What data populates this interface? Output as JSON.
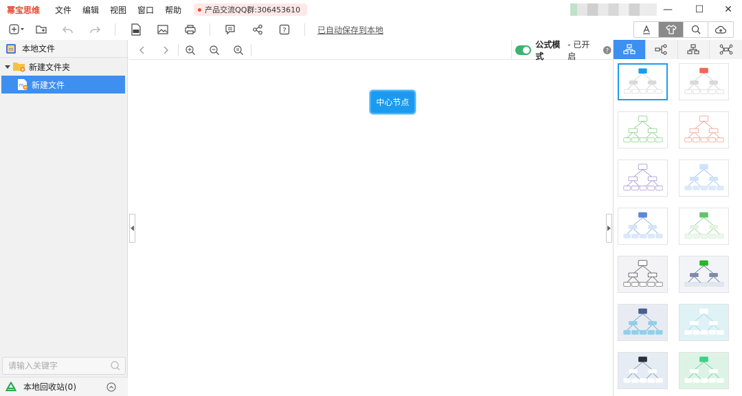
{
  "app": {
    "name": "幂宝思维"
  },
  "menu": [
    "文件",
    "编辑",
    "视图",
    "窗口",
    "帮助"
  ],
  "qq_badge": "产品交流QQ群:306453610",
  "window_controls": {
    "minimize": "—",
    "maximize": "☐",
    "close": "✕"
  },
  "toolbar": {
    "autosave_label": "已自动保存到本地"
  },
  "left_panel": {
    "header": "本地文件",
    "folder": "新建文件夹",
    "file": "新建文件",
    "search_placeholder": "请输入关键字",
    "recycle_bin": "本地回收站(0)"
  },
  "canvas": {
    "formula_mode_label": "公式模式",
    "formula_mode_status": " - 已开启",
    "central_node": "中心节点"
  },
  "colors": {
    "accent": "#3d8ff0",
    "node": "#1b9bf0",
    "brand": "#e8492d",
    "toggle_on": "#3cb371"
  },
  "themes": [
    {
      "top": "#1b9bf0",
      "mid": "#d9d9d9",
      "line": "#cfcfcf",
      "leaf": "#ffffff",
      "leafStroke": "#d9d9d9",
      "bg": "#ffffff",
      "selected": true
    },
    {
      "top": "#f4665a",
      "mid": "#d9d9d9",
      "line": "#cfcfcf",
      "leaf": "#ffffff",
      "leafStroke": "#d9d9d9",
      "bg": "#ffffff"
    },
    {
      "top": "#ffffff",
      "mid": "#ffffff",
      "line": "#8fd18f",
      "leaf": "#ffffff",
      "leafStroke": "#8fd18f",
      "bg": "#ffffff",
      "topStroke": "#8fd18f",
      "midStroke": "#8fd18f"
    },
    {
      "top": "#ffffff",
      "mid": "#ffffff",
      "line": "#f0a294",
      "leaf": "#ffffff",
      "leafStroke": "#f0a294",
      "bg": "#ffffff",
      "topStroke": "#f0a294",
      "midStroke": "#f0a294"
    },
    {
      "top": "#ffffff",
      "mid": "#ffffff",
      "line": "#a99bd6",
      "leaf": "#ffffff",
      "leafStroke": "#a99bd6",
      "bg": "#ffffff",
      "topStroke": "#a99bd6",
      "midStroke": "#a99bd6"
    },
    {
      "top": "#cfe2fb",
      "mid": "#cfe2fb",
      "line": "#9cc3f0",
      "leaf": "#dbe9fb",
      "leafStroke": "#dbe9fb",
      "bg": "#ffffff"
    },
    {
      "top": "#5b87d6",
      "mid": "#d6e4f8",
      "line": "#8fb0e5",
      "leaf": "#dbe8fa",
      "leafStroke": "#dbe8fa",
      "bg": "#ffffff"
    },
    {
      "top": "#66c36a",
      "mid": "#e2f3e2",
      "line": "#97d397",
      "leaf": "#eef8ee",
      "leafStroke": "#d6efd6",
      "bg": "#ffffff"
    },
    {
      "top": "#ffffff",
      "mid": "#ffffff",
      "line": "#777777",
      "leaf": "#ffffff",
      "leafStroke": "#777777",
      "bg": "#f3f3f5",
      "topStroke": "#555555",
      "midStroke": "#555555"
    },
    {
      "top": "#2bb32b",
      "mid": "#7f8aa8",
      "line": "#6e7c9b",
      "leaf": "#e3e7f0",
      "leafStroke": "#d5dbe8",
      "bg": "#f3f4f8"
    },
    {
      "top": "#4a5f8f",
      "mid": "#8fd0ec",
      "line": "#7fa6c9",
      "leaf": "#8fd0ec",
      "leafStroke": "#8fd0ec",
      "bg": "#e8ecf2"
    },
    {
      "top": "#ffffff",
      "mid": "#ffffff",
      "line": "#9fdbe6",
      "leaf": "#ffffff",
      "leafStroke": "#ffffff",
      "bg": "#dff2f6"
    },
    {
      "top": "#2a2f3a",
      "mid": "#ffffff",
      "line": "#8aa0b8",
      "leaf": "#ffffff",
      "leafStroke": "#ffffff",
      "bg": "#e5ecf3"
    },
    {
      "top": "#3fcf86",
      "mid": "#ffffff",
      "line": "#6fd3a0",
      "leaf": "#ffffff",
      "leafStroke": "#ffffff",
      "bg": "#ddf3e6"
    }
  ]
}
